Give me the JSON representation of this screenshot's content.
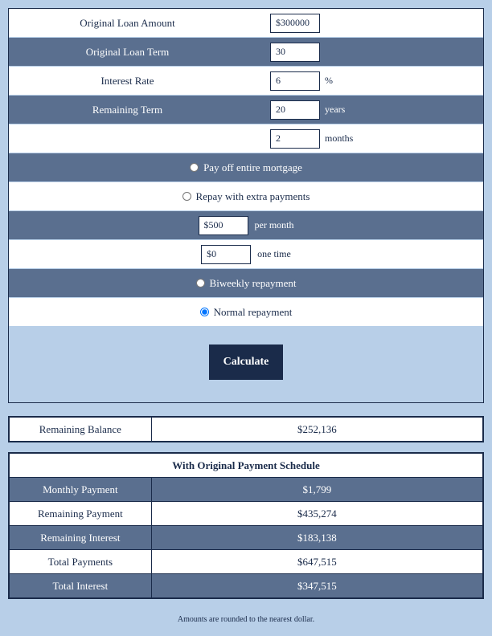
{
  "form": {
    "original_loan_amount": {
      "label": "Original Loan Amount",
      "value": "$300000"
    },
    "original_loan_term": {
      "label": "Original Loan Term",
      "value": "30"
    },
    "interest_rate": {
      "label": "Interest Rate",
      "value": "6",
      "suffix": "%"
    },
    "remaining_term_years": {
      "label": "Remaining Term",
      "value": "20",
      "suffix": "years"
    },
    "remaining_term_months": {
      "value": "2",
      "suffix": "months"
    },
    "options": {
      "payoff": {
        "label": "Pay off entire mortgage",
        "checked": false
      },
      "extra": {
        "label": "Repay with extra payments",
        "checked": false
      },
      "per_month": {
        "value": "$500",
        "suffix": "per month"
      },
      "one_time": {
        "value": "$0",
        "suffix": "one time"
      },
      "biweekly": {
        "label": "Biweekly repayment",
        "checked": false
      },
      "normal": {
        "label": "Normal repayment",
        "checked": true
      }
    },
    "calculate": "Calculate"
  },
  "results": {
    "remaining_balance": {
      "label": "Remaining Balance",
      "value": "$252,136"
    },
    "schedule_header": "With Original Payment Schedule",
    "rows": {
      "monthly_payment": {
        "label": "Monthly Payment",
        "value": "$1,799"
      },
      "remaining_payment": {
        "label": "Remaining Payment",
        "value": "$435,274"
      },
      "remaining_interest": {
        "label": "Remaining Interest",
        "value": "$183,138"
      },
      "total_payments": {
        "label": "Total Payments",
        "value": "$647,515"
      },
      "total_interest": {
        "label": "Total Interest",
        "value": "$347,515"
      }
    }
  },
  "footnote": "Amounts are rounded to the nearest dollar."
}
